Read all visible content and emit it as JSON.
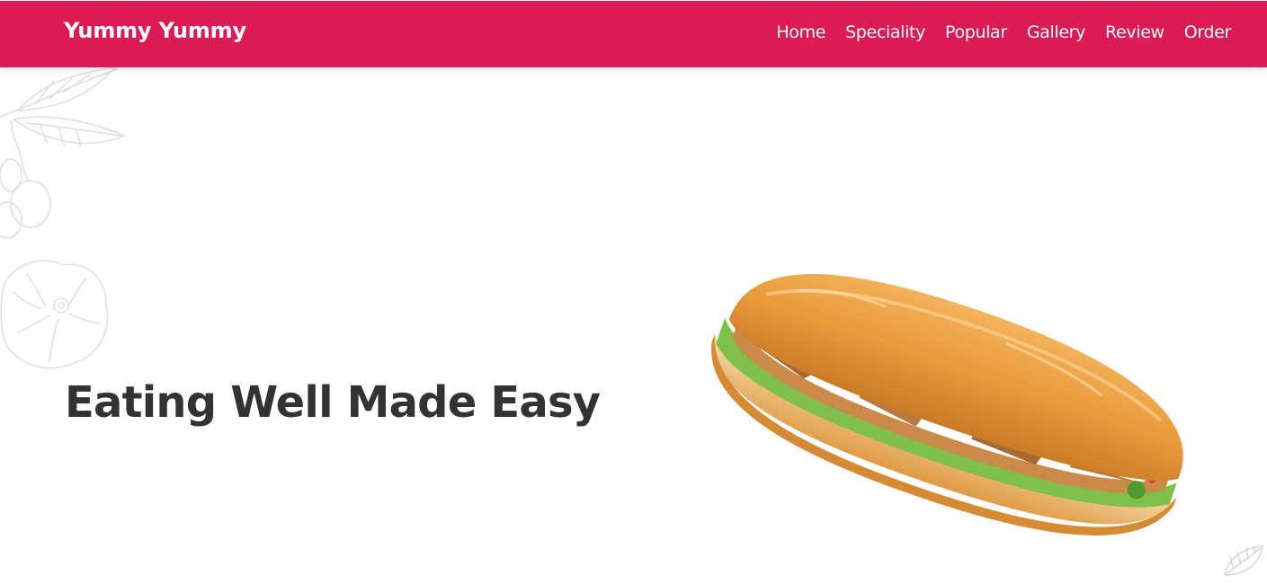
{
  "colors": {
    "brand": "#DC1A56",
    "title": "#333333"
  },
  "navbar": {
    "brand": "Yummy Yummy",
    "links": [
      "Home",
      "Speciality",
      "Popular",
      "Gallery",
      "Review",
      "Order"
    ]
  },
  "hero": {
    "title": "Eating Well Made Easy",
    "image_icon": "sandwich-image"
  },
  "decorations": [
    "leaf-sketch-icon",
    "flower-sketch-icon",
    "leaf-corner-icon"
  ]
}
